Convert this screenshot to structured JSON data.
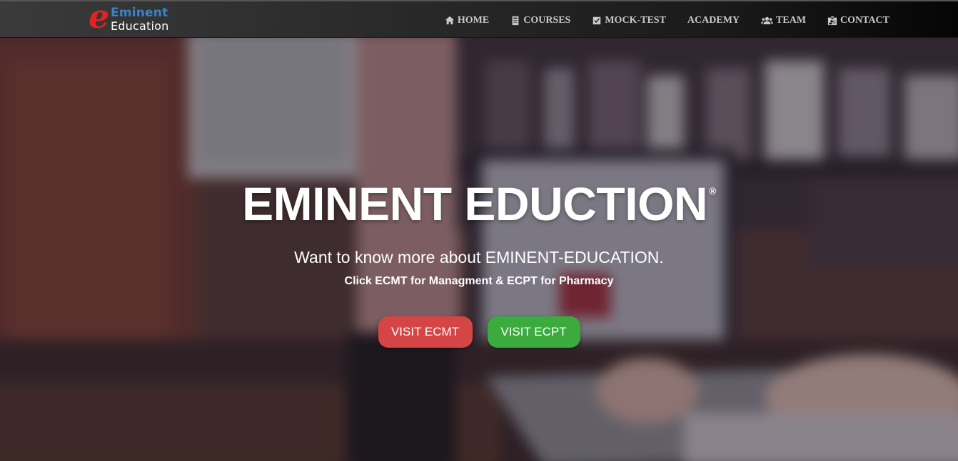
{
  "logo": {
    "letter": "e",
    "line1": "Eminent",
    "line2": "Education"
  },
  "nav": {
    "items": [
      {
        "label": "HOME",
        "icon": "home-icon"
      },
      {
        "label": "COURSES",
        "icon": "book-icon"
      },
      {
        "label": "MOCK-TEST",
        "icon": "check-square-icon"
      },
      {
        "label": "ACADEMY",
        "icon": ""
      },
      {
        "label": "TEAM",
        "icon": "users-icon"
      },
      {
        "label": "CONTACT",
        "icon": "contact-card-icon"
      }
    ]
  },
  "hero": {
    "title": "EMINENT EDUCTION",
    "registered_mark": "®",
    "subtitle": "Want to know more about EMINENT-EDUCATION.",
    "tagline": "Click ECMT for Managment & ECPT for Pharmacy",
    "buttons": {
      "ecmt": "VISIT ECMT",
      "ecpt": "VISIT ECPT"
    }
  },
  "colors": {
    "logo_red": "#e02424",
    "logo_blue": "#3b82c6",
    "ecmt_button": "#d64545",
    "ecpt_button": "#3aab3c",
    "nav_text": "#c9c9c9"
  }
}
